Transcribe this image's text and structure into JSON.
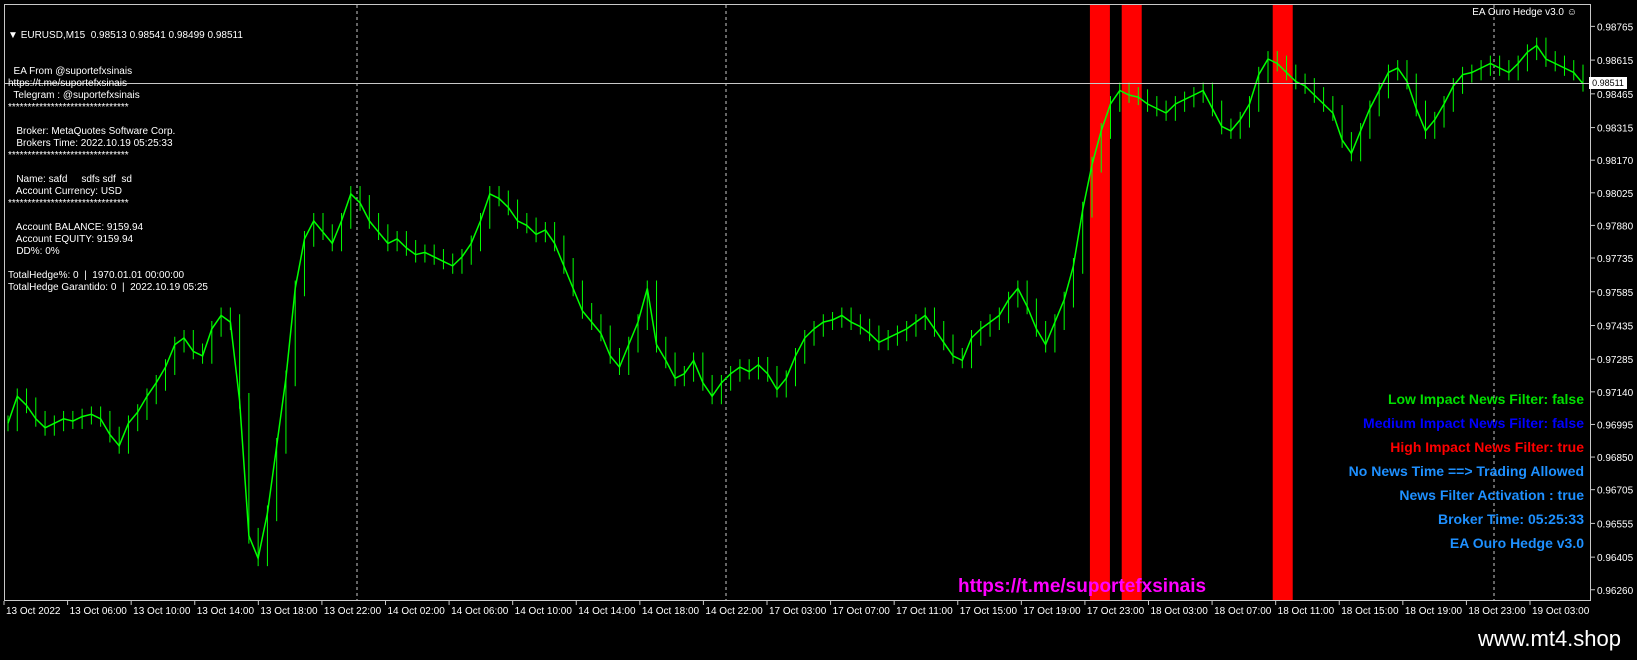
{
  "header": {
    "symbol_line": "EURUSD,M15  0.98513 0.98541 0.98499 0.98511",
    "ea_title": "EA Ouro Hedge v3.0"
  },
  "info_panel": [
    "  EA From @suportefxsinais",
    "https://t.me/suportefxsinais",
    "  Telegram : @suportefxsinais",
    "*******************************",
    "",
    "   Broker: MetaQuotes Software Corp.",
    "   Brokers Time: 2022.10.19 05:25:33",
    "*******************************",
    "",
    "   Name: safd     sdfs sdf  sd",
    "   Account Currency: USD",
    "*******************************",
    "",
    "   Account BALANCE: 9159.94",
    "   Account EQUITY: 9159.94",
    "   DD%: 0%",
    "",
    "TotalHedge%: 0  |  1970.01.01 00:00:00",
    "TotalHedge Garantido: 0  |  2022.10.19 05:25"
  ],
  "news_panel": [
    {
      "text": "Low Impact News Filter: false",
      "color": "#00e000"
    },
    {
      "text": "Medium Impact News Filter: false",
      "color": "#0000ff"
    },
    {
      "text": "High Impact News Filter: true",
      "color": "#ff0000"
    },
    {
      "text": "No News Time ==> Trading Allowed",
      "color": "#1e90ff"
    },
    {
      "text": "News Filter Activation : true",
      "color": "#1e90ff"
    },
    {
      "text": "Broker Time: 05:25:33",
      "color": "#1e90ff"
    },
    {
      "text": "EA Ouro Hedge v3.0",
      "color": "#1e90ff"
    }
  ],
  "link_text": "https://t.me/suportefxsinais",
  "watermark": "www.mt4.shop",
  "colors": {
    "candle": "#00ff00",
    "news_band": "#ff0000",
    "background": "#000000"
  },
  "chart_data": {
    "type": "line",
    "instrument": "EURUSD",
    "timeframe": "M15",
    "current_price": "0.98511",
    "x_tick_labels": [
      "13 Oct 2022",
      "13 Oct 06:00",
      "13 Oct 10:00",
      "13 Oct 14:00",
      "13 Oct 18:00",
      "13 Oct 22:00",
      "14 Oct 02:00",
      "14 Oct 06:00",
      "14 Oct 10:00",
      "14 Oct 14:00",
      "14 Oct 18:00",
      "14 Oct 22:00",
      "17 Oct 03:00",
      "17 Oct 07:00",
      "17 Oct 11:00",
      "17 Oct 15:00",
      "17 Oct 19:00",
      "17 Oct 23:00",
      "18 Oct 03:00",
      "18 Oct 07:00",
      "18 Oct 11:00",
      "18 Oct 15:00",
      "18 Oct 19:00",
      "18 Oct 23:00",
      "19 Oct 03:00"
    ],
    "y_tick_labels": [
      "0.98765",
      "0.98615",
      "0.98465",
      "0.98315",
      "0.98170",
      "0.98025",
      "0.97880",
      "0.97735",
      "0.97585",
      "0.97435",
      "0.97285",
      "0.97140",
      "0.96995",
      "0.96850",
      "0.96705",
      "0.96555",
      "0.96405",
      "0.96260"
    ],
    "ylim": [
      0.9621,
      0.9886
    ],
    "close_series": [
      0.97,
      0.9712,
      0.9708,
      0.9702,
      0.9698,
      0.97,
      0.9702,
      0.9701,
      0.9703,
      0.9704,
      0.9702,
      0.9695,
      0.969,
      0.97,
      0.9705,
      0.9712,
      0.9718,
      0.9725,
      0.9735,
      0.9738,
      0.9732,
      0.973,
      0.9742,
      0.9748,
      0.9745,
      0.971,
      0.965,
      0.964,
      0.966,
      0.969,
      0.972,
      0.976,
      0.9782,
      0.979,
      0.9785,
      0.978,
      0.979,
      0.9802,
      0.9798,
      0.979,
      0.9785,
      0.978,
      0.9782,
      0.9778,
      0.9775,
      0.9776,
      0.9774,
      0.9772,
      0.977,
      0.9774,
      0.978,
      0.979,
      0.9802,
      0.98,
      0.9796,
      0.979,
      0.9788,
      0.9784,
      0.9786,
      0.978,
      0.977,
      0.976,
      0.975,
      0.9745,
      0.974,
      0.973,
      0.9725,
      0.9735,
      0.9745,
      0.976,
      0.9735,
      0.9728,
      0.972,
      0.9722,
      0.9728,
      0.9718,
      0.9712,
      0.9718,
      0.9722,
      0.9725,
      0.9723,
      0.9726,
      0.9722,
      0.9715,
      0.972,
      0.973,
      0.9738,
      0.9742,
      0.9745,
      0.9746,
      0.9748,
      0.9745,
      0.9743,
      0.974,
      0.9736,
      0.9738,
      0.974,
      0.9742,
      0.9745,
      0.9748,
      0.9742,
      0.9736,
      0.973,
      0.9728,
      0.9738,
      0.9742,
      0.9745,
      0.9748,
      0.9755,
      0.976,
      0.9752,
      0.9742,
      0.9735,
      0.9745,
      0.9755,
      0.977,
      0.9795,
      0.9815,
      0.983,
      0.9842,
      0.9848,
      0.9846,
      0.9845,
      0.9842,
      0.984,
      0.9838,
      0.9842,
      0.9844,
      0.9846,
      0.9848,
      0.984,
      0.9832,
      0.983,
      0.9835,
      0.9842,
      0.9855,
      0.9862,
      0.986,
      0.9856,
      0.9852,
      0.985,
      0.9846,
      0.9842,
      0.9838,
      0.9826,
      0.982,
      0.983,
      0.984,
      0.9848,
      0.9856,
      0.9858,
      0.9852,
      0.984,
      0.983,
      0.9835,
      0.9842,
      0.985,
      0.9855,
      0.9856,
      0.9858,
      0.986,
      0.9858,
      0.9856,
      0.986,
      0.9865,
      0.9868,
      0.9862,
      0.986,
      0.9858,
      0.9856,
      0.9851
    ],
    "news_bands": [
      {
        "from": "17 Oct 23:00",
        "to": "18 Oct 00:00"
      },
      {
        "from": "18 Oct 01:00",
        "to": "18 Oct 02:00"
      },
      {
        "from": "18 Oct 10:30",
        "to": "18 Oct 11:30"
      }
    ],
    "grid": false
  }
}
